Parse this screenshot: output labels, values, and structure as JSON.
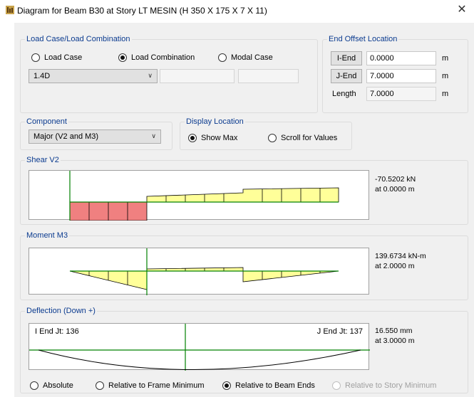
{
  "window": {
    "title": "Diagram for Beam B30 at Story LT MESIN (H 350 X 175 X 7 X 11)",
    "close_glyph": "✕"
  },
  "load_group": {
    "legend": "Load Case/Load Combination",
    "options": [
      {
        "label": "Load Case",
        "selected": false
      },
      {
        "label": "Load Combination",
        "selected": true
      },
      {
        "label": "Modal Case",
        "selected": false
      }
    ],
    "combo_value": "1.4D"
  },
  "end_offset": {
    "legend": "End Offset Location",
    "iend_label": "I-End",
    "iend_value": "0.0000",
    "jend_label": "J-End",
    "jend_value": "7.0000",
    "length_label": "Length",
    "length_value": "7.0000",
    "unit": "m"
  },
  "component": {
    "legend": "Component",
    "value": "Major (V2 and M3)"
  },
  "display_location": {
    "legend": "Display Location",
    "options": [
      {
        "label": "Show Max",
        "selected": true
      },
      {
        "label": "Scroll for Values",
        "selected": false
      }
    ]
  },
  "shear": {
    "legend": "Shear V2",
    "value_text": "-70.5202 kN",
    "location_text": "at 0.0000 m"
  },
  "moment": {
    "legend": "Moment M3",
    "value_text": "139.6734 kN-m",
    "location_text": "at 2.0000 m"
  },
  "deflection": {
    "legend": "Deflection (Down +)",
    "iend_text": "I End Jt: 136",
    "jend_text": "J End Jt: 137",
    "value_text": "16.550 mm",
    "location_text": "at 3.0000 m",
    "options": [
      {
        "label": "Absolute",
        "selected": false,
        "enabled": true
      },
      {
        "label": "Relative to Frame Minimum",
        "selected": false,
        "enabled": true
      },
      {
        "label": "Relative to Beam Ends",
        "selected": true,
        "enabled": true
      },
      {
        "label": "Relative to Story Minimum",
        "selected": false,
        "enabled": false
      }
    ]
  },
  "colors": {
    "negative_fill": "#f08080",
    "positive_fill": "#ffff99",
    "baseline": "#008000",
    "deflected": "#000000",
    "legend_text": "#0b3b8f"
  }
}
